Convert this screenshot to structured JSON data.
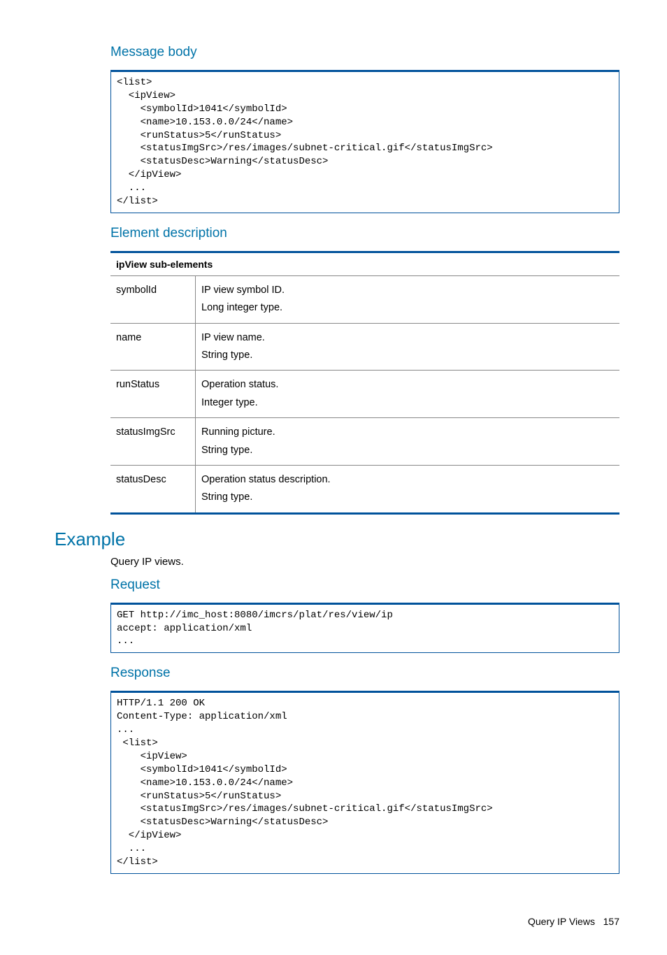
{
  "headings": {
    "message_body": "Message body",
    "element_description": "Element description",
    "example": "Example",
    "request": "Request",
    "response": "Response"
  },
  "code": {
    "message_body": "<list>\n  <ipView>\n    <symbolId>1041</symbolId>\n    <name>10.153.0.0/24</name>\n    <runStatus>5</runStatus>\n    <statusImgSrc>/res/images/subnet-critical.gif</statusImgSrc>\n    <statusDesc>Warning</statusDesc>\n  </ipView>\n  ...\n</list>",
    "request": "GET http://imc_host:8080/imcrs/plat/res/view/ip\naccept: application/xml\n...",
    "response": "HTTP/1.1 200 OK\nContent-Type: application/xml\n...\n <list>\n    <ipView>\n    <symbolId>1041</symbolId>\n    <name>10.153.0.0/24</name>\n    <runStatus>5</runStatus>\n    <statusImgSrc>/res/images/subnet-critical.gif</statusImgSrc>\n    <statusDesc>Warning</statusDesc>\n  </ipView>\n  ...\n</list>"
  },
  "table": {
    "header": "ipView sub-elements",
    "rows": [
      {
        "key": "symbolId",
        "line1": "IP view symbol ID.",
        "line2": "Long integer type."
      },
      {
        "key": "name",
        "line1": "IP view name.",
        "line2": "String type."
      },
      {
        "key": "runStatus",
        "line1": "Operation status.",
        "line2": "Integer type."
      },
      {
        "key": "statusImgSrc",
        "line1": "Running picture.",
        "line2": "String type."
      },
      {
        "key": "statusDesc",
        "line1": "Operation status description.",
        "line2": "String type."
      }
    ]
  },
  "example_intro": "Query IP views.",
  "footer": {
    "title": "Query IP Views",
    "page": "157"
  }
}
